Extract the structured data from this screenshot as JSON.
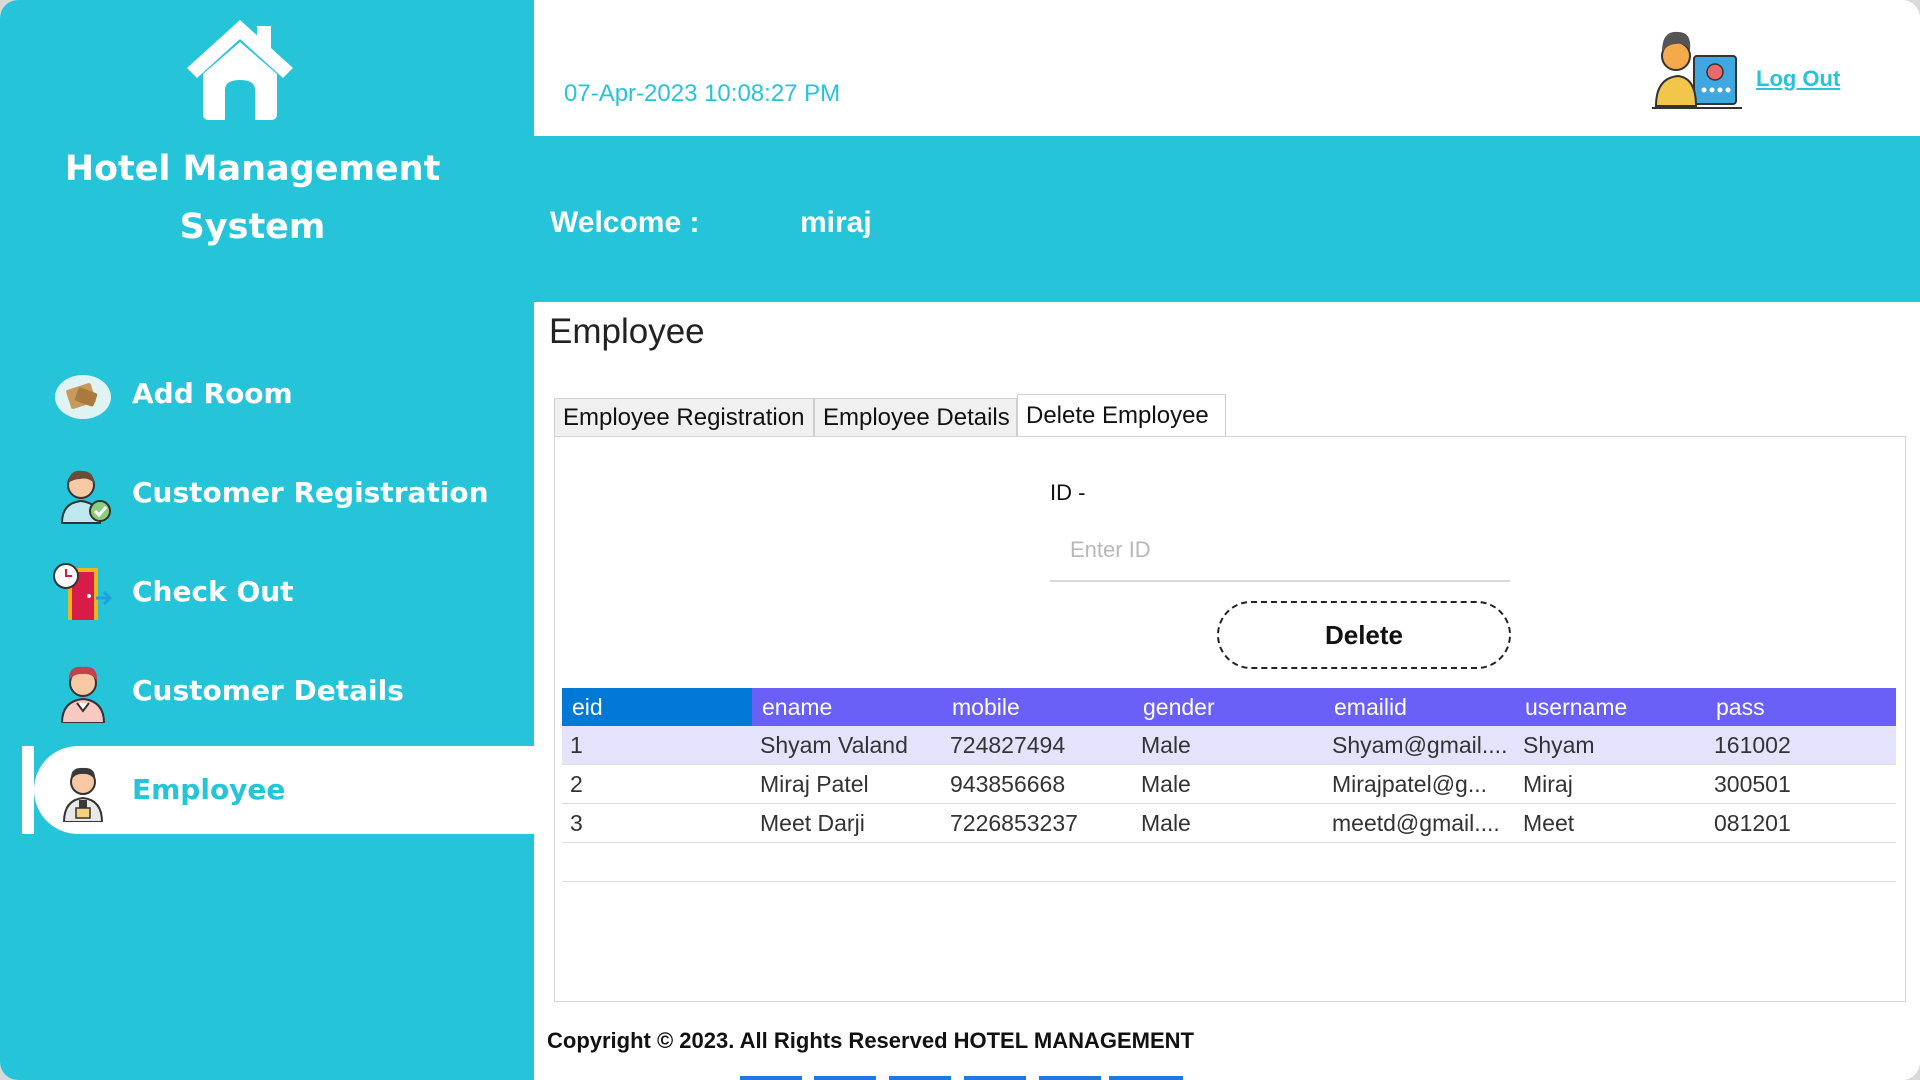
{
  "app": {
    "title": "Hotel Management System",
    "brand_color": "#26c4d9"
  },
  "sidebar": {
    "items": [
      {
        "label": "Add Room",
        "icon": "room-icon",
        "active": false
      },
      {
        "label": "Customer Registration",
        "icon": "customer-registration-icon",
        "active": false
      },
      {
        "label": "Check Out",
        "icon": "check-out-icon",
        "active": false
      },
      {
        "label": "Customer Details",
        "icon": "customer-details-icon",
        "active": false
      },
      {
        "label": "Employee",
        "icon": "employee-icon",
        "active": true
      }
    ]
  },
  "header": {
    "datetime": "07-Apr-2023 10:08:27 PM",
    "logout_label": "Log Out",
    "welcome_label": "Welcome :",
    "username": "miraj"
  },
  "main": {
    "title": "Employee",
    "tabs": [
      {
        "label": "Employee Registration",
        "active": false
      },
      {
        "label": "Employee Details",
        "active": false
      },
      {
        "label": "Delete Employee",
        "active": true
      }
    ],
    "delete_form": {
      "id_label": "ID  -",
      "id_placeholder": "Enter ID",
      "id_value": "",
      "delete_label": "Delete"
    },
    "table": {
      "columns": [
        "eid",
        "ename",
        "mobile",
        "gender",
        "emailid",
        "username",
        "pass"
      ],
      "rows": [
        [
          "1",
          "Shyam Valand",
          "724827494",
          "Male",
          "Shyam@gmail....",
          "Shyam",
          "161002"
        ],
        [
          "2",
          "Miraj Patel",
          "943856668",
          "Male",
          "Mirajpatel@g...",
          "Miraj",
          "300501"
        ],
        [
          "3",
          "Meet Darji",
          "7226853237",
          "Male",
          "meetd@gmail....",
          "Meet",
          "081201"
        ]
      ]
    }
  },
  "footer": {
    "copyright": "Copyright © 2023. All Rights Reserved HOTEL MANAGEMENT"
  }
}
